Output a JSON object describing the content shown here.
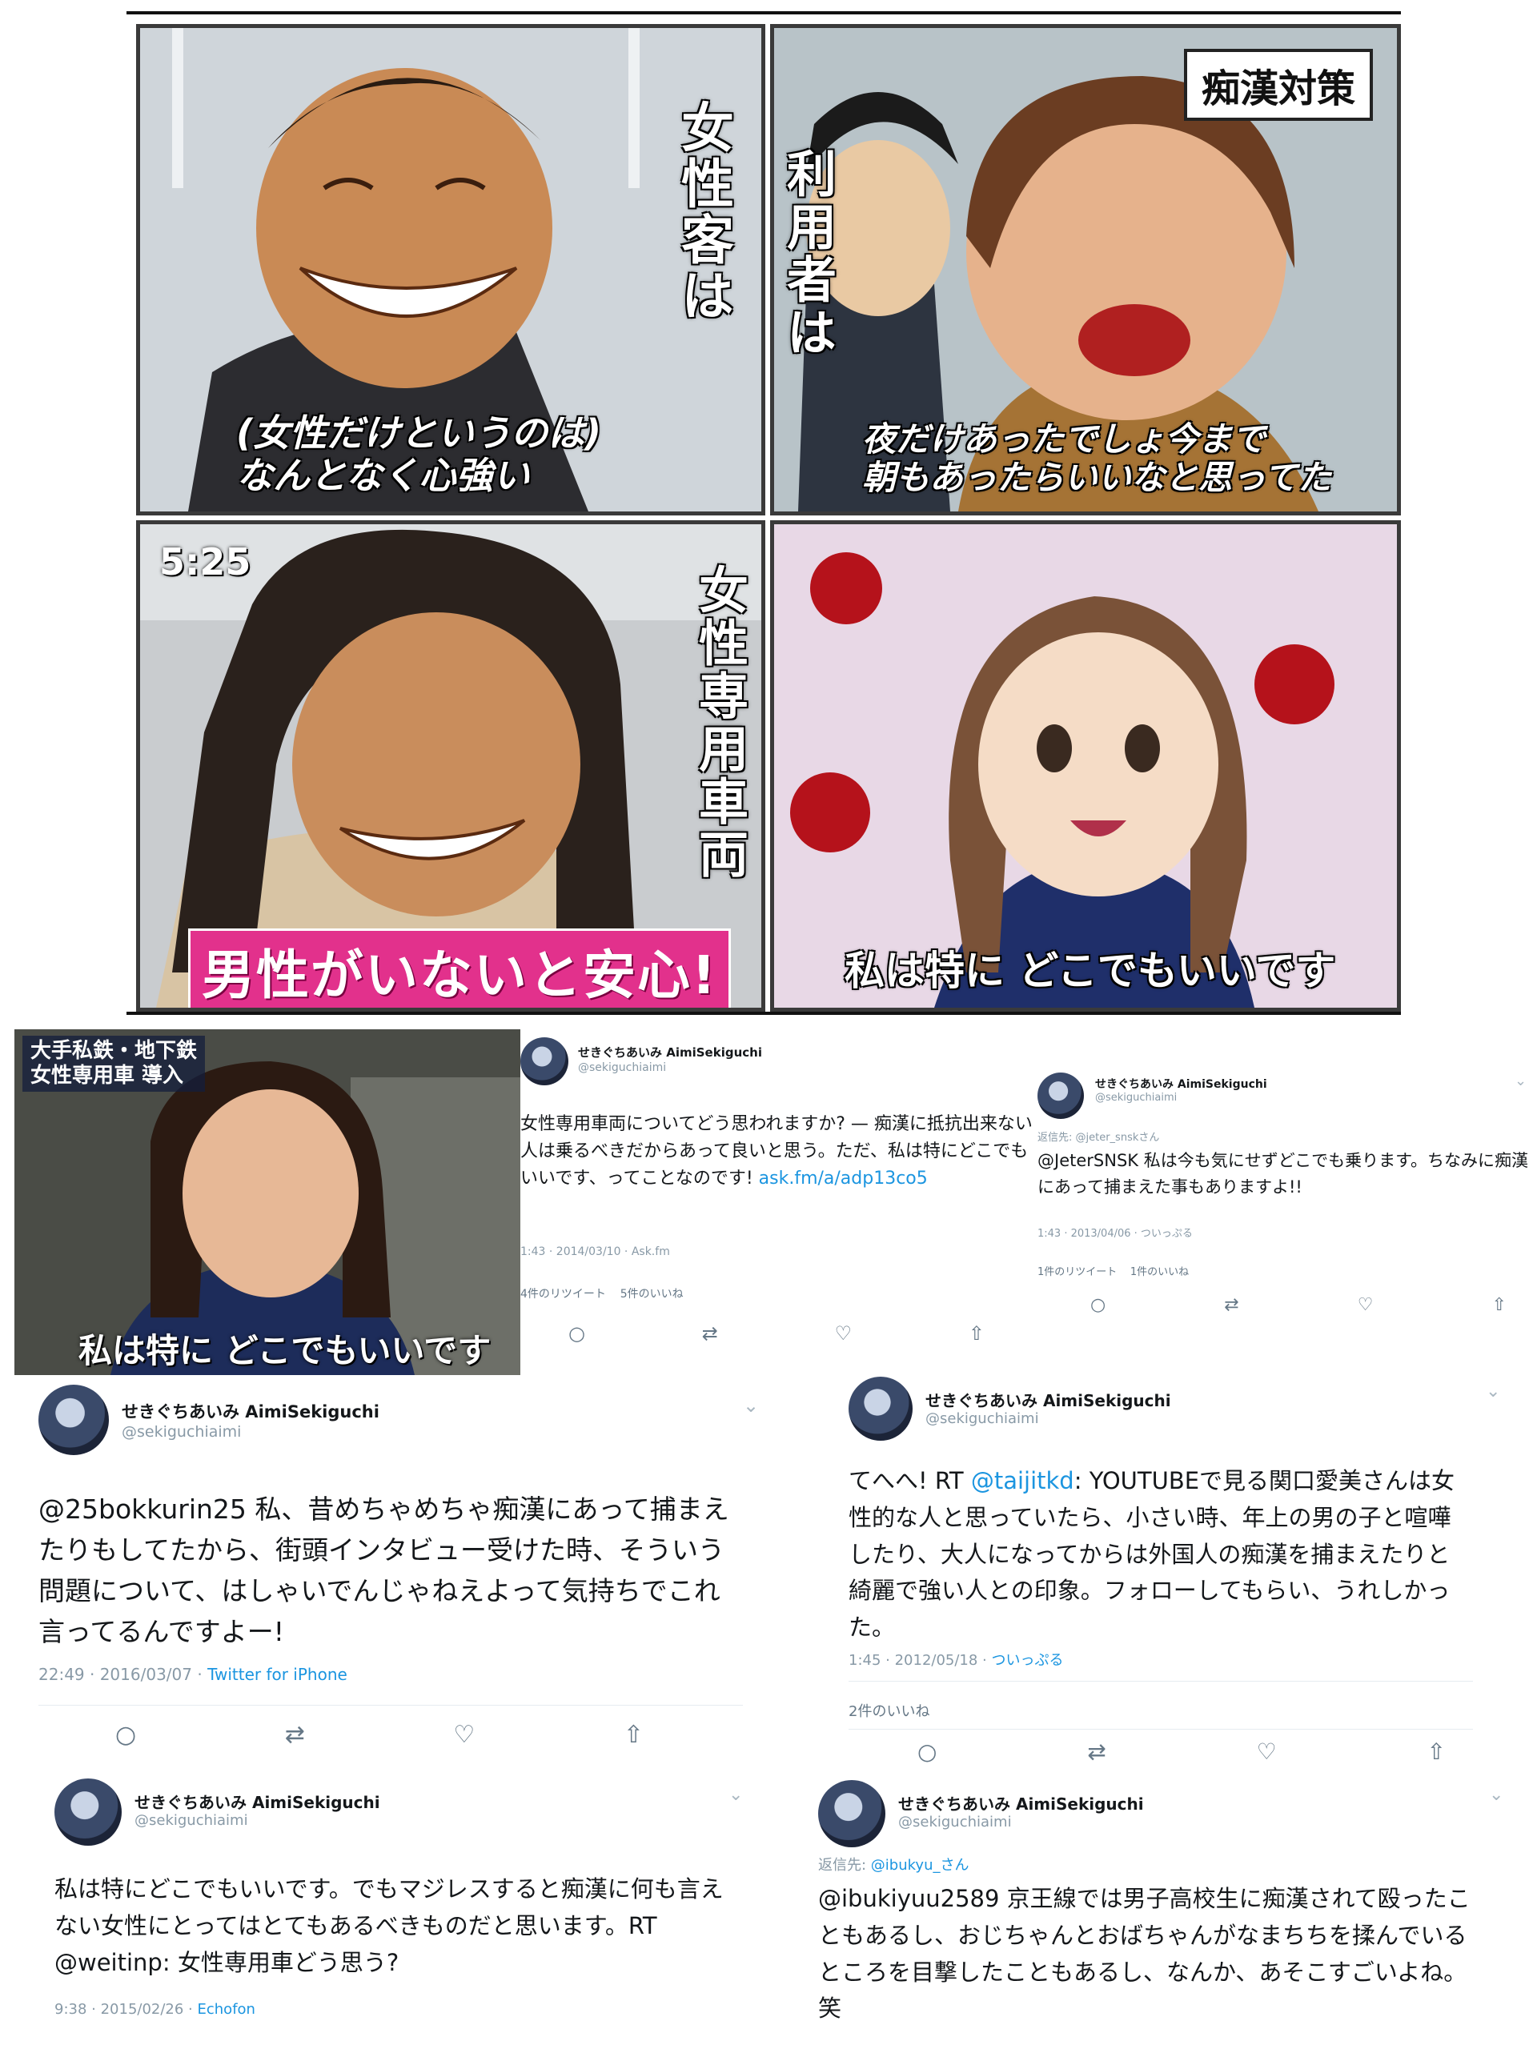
{
  "manga": {
    "panel1": {
      "vertical": "女性客は",
      "caption": "(女性だけというのは)\nなんとなく心強い"
    },
    "panel2": {
      "badge": "痴漢対策",
      "vertical": "利用者は",
      "caption": "夜だけあったでしょ今まで\n朝もあったらいいなと思ってた"
    },
    "panel3": {
      "clock": "5:25",
      "vertical": "女性専用車両",
      "caption": "男性がいないと安心!"
    },
    "panel4": {
      "caption": "私は特に どこでもいいです"
    }
  },
  "tv": {
    "banner_line1": "大手私鉄・地下鉄",
    "banner_line2": "女性専用車 導入",
    "subtitle": "私は特に どこでもいいです"
  },
  "tweet_a": {
    "name": "せきぐちあいみ AimiSekiguchi",
    "handle": "@sekiguchiaimi",
    "body_text": "女性専用車両についてどう思われますか? — 痴漢に抵抗出来ない人は乗るべきだからあって良いと思う。ただ、私は特にどこでもいいです、ってことなのです!",
    "link": "ask.fm/a/adp13co5",
    "meta": "1:43 · 2014/03/10 · Ask.fm",
    "retweets": "4件のリツイート",
    "likes": "5件のいいね"
  },
  "tweet_b": {
    "name": "せきぐちあいみ AimiSekiguchi",
    "handle": "@sekiguchiaimi",
    "reply_to": "返信先: @jeter_snskさん",
    "body": "@JeterSNSK 私は今も気にせずどこでも乗ります。ちなみに痴漢にあって捕まえた事もありますよ!!",
    "meta": "1:43 · 2013/04/06 · ついっぷる",
    "retweets": "1件のリツイート",
    "likes": "1件のいいね"
  },
  "tweet_c": {
    "name": "せきぐちあいみ AimiSekiguchi",
    "handle": "@sekiguchiaimi",
    "body": "@25bokkurin25 私、昔めちゃめちゃ痴漢にあって捕まえたりもしてたから、街頭インタビュー受けた時、そういう問題について、はしゃいでんじゃねえよって気持ちでこれ言ってるんですよー!",
    "meta_time": "22:49 · 2016/03/07 · ",
    "meta_source": "Twitter for iPhone"
  },
  "tweet_d": {
    "name": "せきぐちあいみ AimiSekiguchi",
    "handle": "@sekiguchiaimi",
    "body_pre": "てへへ! RT ",
    "body_mention": "@taijitkd",
    "body_post": ": YOUTUBEで見る関口愛美さんは女性的な人と思っていたら、小さい時、年上の男の子と喧嘩したり、大人になってからは外国人の痴漢を捕まえたりと綺麗で強い人との印象。フォローしてもらい、うれしかった。",
    "meta_time": "1:45 · 2012/05/18 · ",
    "meta_source": "ついっぷる",
    "likes": "2件のいいね"
  },
  "tweet_e": {
    "name": "せきぐちあいみ AimiSekiguchi",
    "handle": "@sekiguchiaimi",
    "body": "私は特にどこでもいいです。でもマジレスすると痴漢に何も言えない女性にとってはとてもあるべきものだと思います。RT @weitinp: 女性専用車どう思う?",
    "meta_time": "9:38 · 2015/02/26 · ",
    "meta_source": "Echofon"
  },
  "tweet_f": {
    "name": "せきぐちあいみ AimiSekiguchi",
    "handle": "@sekiguchiaimi",
    "reply_label": "返信先: ",
    "reply_handle": "@ibukyu_さん",
    "body": "@ibukiyuu2589 京王線では男子高校生に痴漢されて殴ったこともあるし、おじちゃんとおばちゃんがなまちちを揉んでいるところを目撃したこともあるし、なんか、あそこすごいよね。笑"
  },
  "icons": {
    "reply": "reply-icon",
    "retweet": "retweet-icon",
    "like": "heart-icon",
    "share": "share-icon",
    "more": "chevron-down-icon"
  },
  "colors": {
    "link": "#1b95e0",
    "muted": "#8899a6",
    "caption_pink": "#e2318c"
  }
}
